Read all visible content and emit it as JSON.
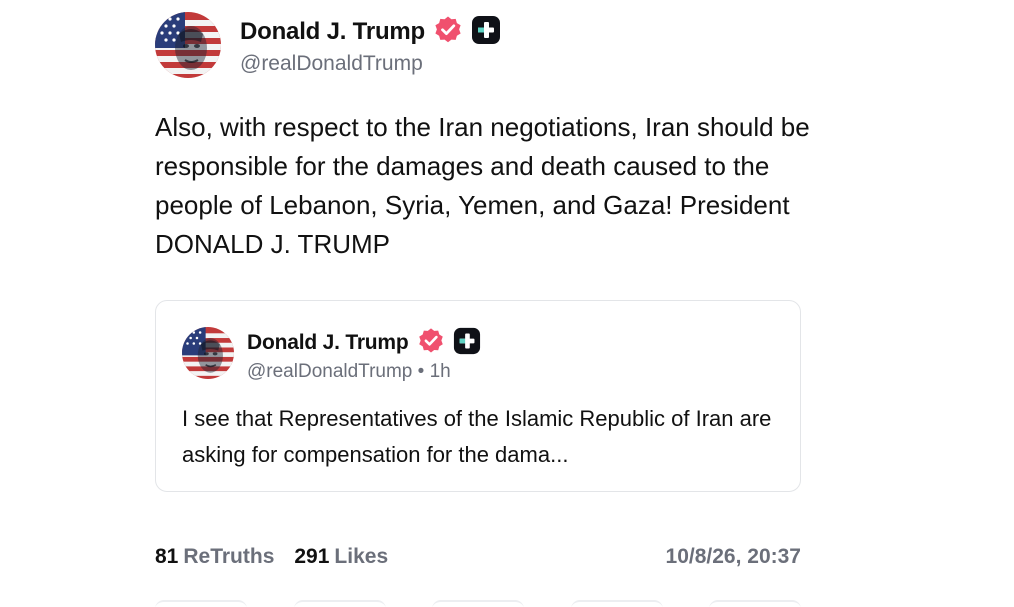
{
  "post": {
    "author": {
      "display_name": "Donald J. Trump",
      "handle": "@realDonaldTrump",
      "verified_icon": "verified-badge-icon",
      "plus_icon": "plus-badge-icon"
    },
    "text": "Also, with respect to the Iran negotiations, Iran should be responsible for the damages and death caused to the people of Lebanon, Syria, Yemen, and Gaza! President DONALD J. TRUMP",
    "quote": {
      "display_name": "Donald J. Trump",
      "handle": "@realDonaldTrump",
      "separator": "•",
      "age": "1h",
      "text": "I see that Representatives of the Islamic Republic of Iran are asking for compensation for the dama..."
    },
    "stats": {
      "retruths_count": "81",
      "retruths_label": "ReTruths",
      "likes_count": "291",
      "likes_label": "Likes",
      "timestamp": "10/8/26, 20:37"
    }
  },
  "colors": {
    "verified": "#f0506e",
    "plus_badge": "#0f1117",
    "secondary_text": "#6b6f7a",
    "border": "#e3e5e8"
  }
}
